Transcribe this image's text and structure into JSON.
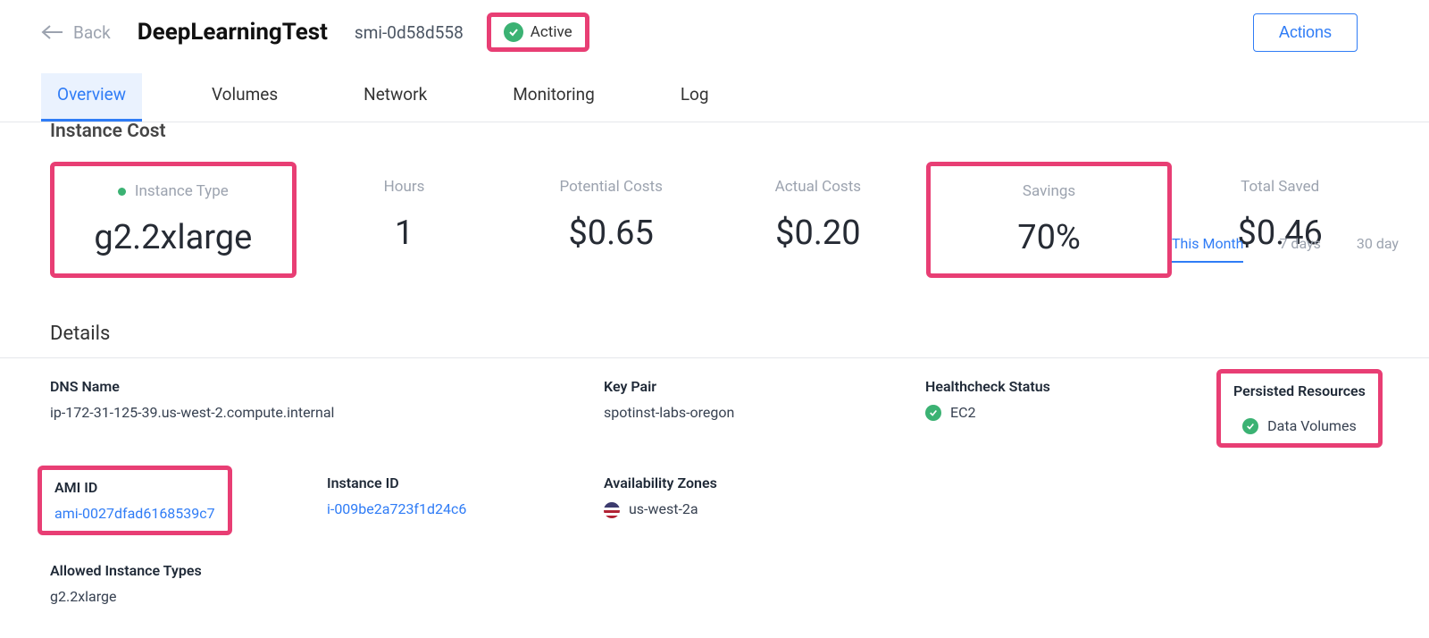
{
  "header": {
    "back_label": "Back",
    "title": "DeepLearningTest",
    "sub_id": "smi-0d58d558",
    "status": "Active",
    "actions_label": "Actions"
  },
  "tabs": [
    "Overview",
    "Volumes",
    "Network",
    "Monitoring",
    "Log"
  ],
  "active_tab": 0,
  "section_title": "Instance Cost",
  "period_tabs": [
    "This Month",
    "7 days",
    "30 day"
  ],
  "active_period": 0,
  "metrics": [
    {
      "label": "Instance Type",
      "value": "g2.2xlarge",
      "dot": true,
      "highlight": true
    },
    {
      "label": "Hours",
      "value": "1"
    },
    {
      "label": "Potential Costs",
      "value": "$0.65"
    },
    {
      "label": "Actual Costs",
      "value": "$0.20"
    },
    {
      "label": "Savings",
      "value": "70%",
      "highlight": true
    },
    {
      "label": "Total Saved",
      "value": "$0.46"
    }
  ],
  "details_title": "Details",
  "details": {
    "dns_name": {
      "label": "DNS Name",
      "value": "ip-172-31-125-39.us-west-2.compute.internal"
    },
    "key_pair": {
      "label": "Key Pair",
      "value": "spotinst-labs-oregon"
    },
    "healthcheck": {
      "label": "Healthcheck Status",
      "value": "EC2"
    },
    "persisted": {
      "label": "Persisted Resources",
      "value": "Data Volumes"
    },
    "ami_id": {
      "label": "AMI ID",
      "value": "ami-0027dfad6168539c7"
    },
    "instance_id": {
      "label": "Instance ID",
      "value": "i-009be2a723f1d24c6"
    },
    "az": {
      "label": "Availability Zones",
      "value": "us-west-2a"
    },
    "allowed_types": {
      "label": "Allowed Instance Types",
      "value": "g2.2xlarge"
    }
  }
}
